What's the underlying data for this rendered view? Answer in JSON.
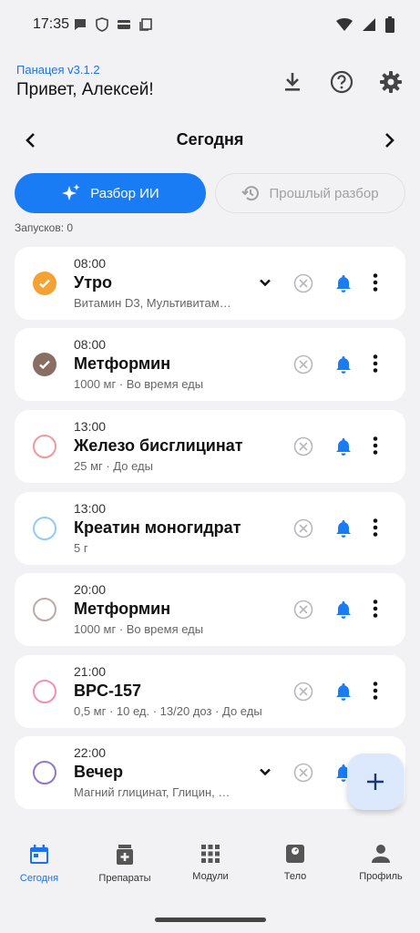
{
  "status_bar": {
    "time": "17:35"
  },
  "header": {
    "app_version": "Панацея v3.1.2",
    "greeting": "Привет, Алексей!"
  },
  "date_nav": {
    "label": "Сегодня"
  },
  "actions": {
    "ai_button": "Разбор ИИ",
    "previous_button": "Прошлый разбор",
    "launches": "Запусков: 0"
  },
  "accent_color": "#1a7cf5",
  "items": [
    {
      "time": "08:00",
      "title": "Утро",
      "subtitle": "Витамин D3, Мультивитам…",
      "checked": true,
      "color": "#f4a234",
      "has_chevron": true
    },
    {
      "time": "08:00",
      "title": "Метформин",
      "subtitle": "1000 мг · Во время еды",
      "checked": true,
      "color": "#8a6e62",
      "has_chevron": false
    },
    {
      "time": "13:00",
      "title": "Железо бисглицинат",
      "subtitle": "25 мг · До еды",
      "checked": false,
      "color": "#ef9a9a",
      "has_chevron": false
    },
    {
      "time": "13:00",
      "title": "Креатин моногидрат",
      "subtitle": "5 г",
      "checked": false,
      "color": "#90caf9",
      "has_chevron": false
    },
    {
      "time": "20:00",
      "title": "Метформин",
      "subtitle": "1000 мг · Во время еды",
      "checked": false,
      "color": "#bcaaa4",
      "has_chevron": false
    },
    {
      "time": "21:00",
      "title": "BPC-157",
      "subtitle": "0,5 мг · 10 ед. · 13/20 доз · До еды",
      "checked": false,
      "color": "#f48fb1",
      "has_chevron": false
    },
    {
      "time": "22:00",
      "title": "Вечер",
      "subtitle": "Магний глицинат, Глицин, …",
      "checked": false,
      "color": "#9575cd",
      "has_chevron": true
    }
  ],
  "bottom_nav": [
    {
      "label": "Сегодня",
      "icon": "calendar-icon",
      "active": true
    },
    {
      "label": "Препараты",
      "icon": "medication-icon",
      "active": false
    },
    {
      "label": "Модули",
      "icon": "grid-icon",
      "active": false
    },
    {
      "label": "Тело",
      "icon": "scale-icon",
      "active": false
    },
    {
      "label": "Профиль",
      "icon": "person-icon",
      "active": false
    }
  ]
}
